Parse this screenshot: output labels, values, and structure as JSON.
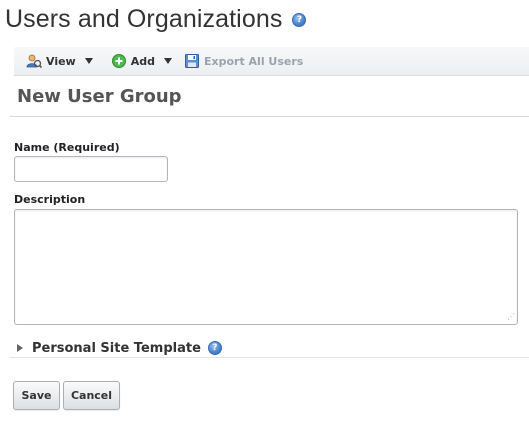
{
  "page": {
    "title": "Users and Organizations"
  },
  "toolbar": {
    "view_label": "View",
    "add_label": "Add",
    "export_label": "Export All Users"
  },
  "form": {
    "section_title": "New User Group",
    "name_label": "Name (Required)",
    "name_value": "",
    "description_label": "Description",
    "description_value": "",
    "panel_title": "Personal Site Template",
    "save_label": "Save",
    "cancel_label": "Cancel"
  },
  "icons": {
    "help": "help-icon",
    "view": "users-view-icon",
    "add": "add-icon",
    "export": "floppy-disk-icon",
    "panel_toggle": "caret-right-icon"
  },
  "colors": {
    "help_icon_blue": "#4d86cf",
    "add_icon_green": "#3aa23a",
    "export_disabled_text": "#9aa3ad"
  }
}
